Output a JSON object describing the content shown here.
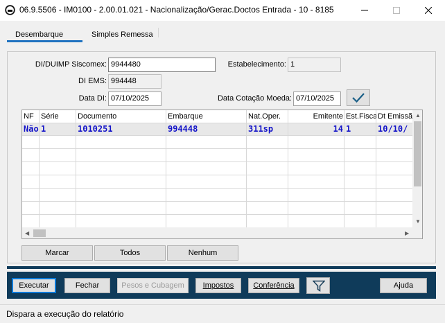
{
  "window": {
    "title": "06.9.5506 - IM0100 - 2.00.01.021 - Nacionalização/Gerac.Doctos Entrada - 10 - 8185"
  },
  "tabs": [
    {
      "label": "Desembarque",
      "active": true
    },
    {
      "label": "Simples Remessa",
      "active": false
    }
  ],
  "form": {
    "di_label": "DI/DUIMP Siscomex:",
    "di_value": "9944480",
    "estab_label": "Estabelecimento:",
    "estab_value": "1",
    "di_ems_label": "DI EMS:",
    "di_ems_value": "994448",
    "data_di_label": "Data DI:",
    "data_di_value": "07/10/2025",
    "data_cot_label": "Data Cotação Moeda:",
    "data_cot_value": "07/10/2025"
  },
  "grid": {
    "headers": [
      "NF",
      "Série",
      "Documento",
      "Embarque",
      "Nat.Oper.",
      "Emitente",
      "Est.Fiscal",
      "Dt Emissão"
    ],
    "rows": [
      [
        "Não",
        "1",
        "1010251",
        "994448",
        "311sp",
        "14",
        "1",
        "10/10/"
      ]
    ]
  },
  "actions": {
    "marcar": "Marcar",
    "todos": "Todos",
    "nenhum": "Nenhum"
  },
  "toolbar": {
    "executar": "Executar",
    "fechar": "Fechar",
    "pesos": "Pesos e Cubagem",
    "impostos": "Impostos",
    "conferencia": "Conferência",
    "ajuda": "Ajuda"
  },
  "icons": {
    "confirm": "checkmark-icon",
    "filter": "funnel-icon"
  },
  "colors": {
    "accent": "#0078d7",
    "tab_underline": "#1f72c0",
    "toolbar_bg": "#0f3b5a",
    "grid_text": "#1414c8"
  },
  "status": {
    "text": "Dispara a execução do relatório"
  }
}
